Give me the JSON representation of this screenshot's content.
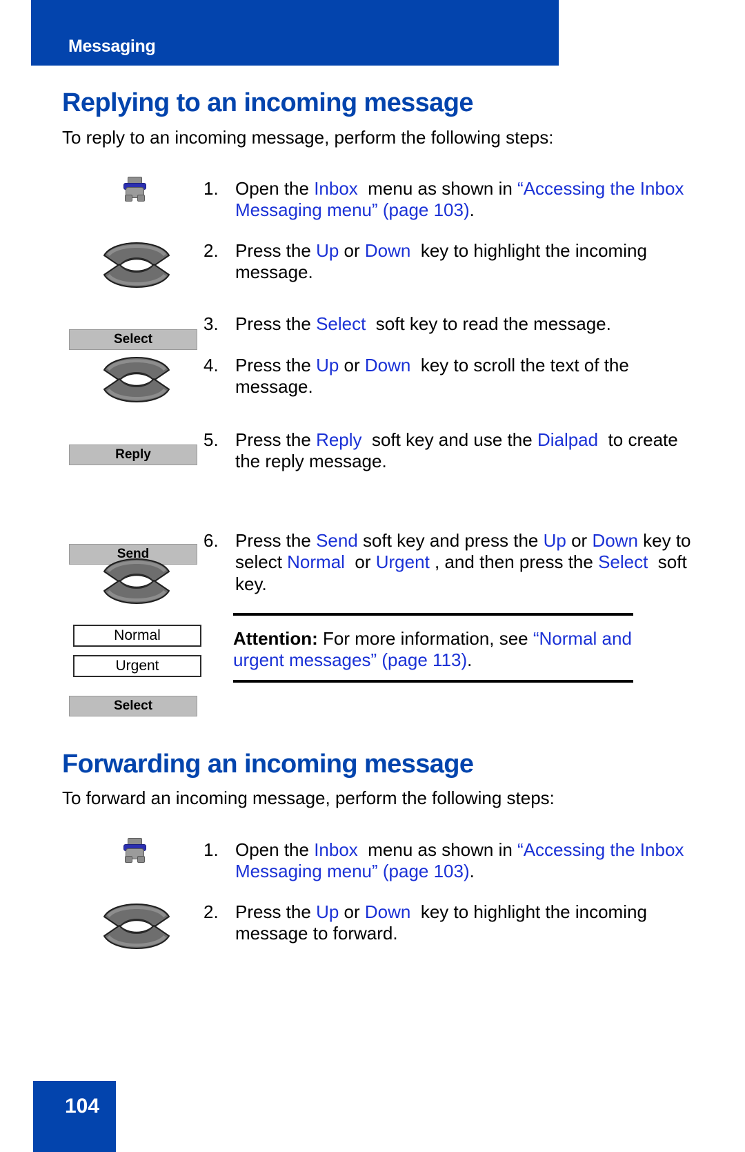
{
  "header": {
    "title": "Messaging",
    "bar_color": "#0344ad"
  },
  "colors": {
    "brand_blue": "#0344ad",
    "link_blue": "#1a31d6",
    "softkey_gray": "#bdbdbd"
  },
  "sections": [
    {
      "id": "replying",
      "heading": "Replying to an incoming message",
      "intro": "To reply to an incoming message, perform the following steps:",
      "steps": [
        {
          "number": "1.",
          "icon": "inbox-globe-icon",
          "text_runs": [
            {
              "t": "Open the ",
              "c": "black"
            },
            {
              "t": "Inbox",
              "c": "blue"
            },
            {
              "t": "  menu as shown in ",
              "c": "black"
            },
            {
              "t": "“Accessing the Inbox Messaging menu” (page 103)",
              "c": "blue"
            },
            {
              "t": ".",
              "c": "black"
            }
          ]
        },
        {
          "number": "2.",
          "icon": "navigation-rocker-key-icon",
          "text_runs": [
            {
              "t": "Press the ",
              "c": "black"
            },
            {
              "t": "Up",
              "c": "blue"
            },
            {
              "t": " or ",
              "c": "black"
            },
            {
              "t": "Down",
              "c": "blue"
            },
            {
              "t": "  key to highlight the incoming message.",
              "c": "black"
            }
          ]
        },
        {
          "number": "3.",
          "icon": "softkey-select",
          "softkey_label": "Select",
          "text_runs": [
            {
              "t": "Press the ",
              "c": "black"
            },
            {
              "t": "Select",
              "c": "blue"
            },
            {
              "t": "  soft key to read the message.",
              "c": "black"
            }
          ]
        },
        {
          "number": "4.",
          "icon": "navigation-rocker-key-icon",
          "text_runs": [
            {
              "t": "Press the ",
              "c": "black"
            },
            {
              "t": "Up",
              "c": "blue"
            },
            {
              "t": " or ",
              "c": "black"
            },
            {
              "t": "Down",
              "c": "blue"
            },
            {
              "t": "  key to scroll the text of the message.",
              "c": "black"
            }
          ]
        },
        {
          "number": "5.",
          "icon": "softkey-reply",
          "softkey_label": "Reply",
          "text_runs": [
            {
              "t": "Press the ",
              "c": "black"
            },
            {
              "t": "Reply",
              "c": "blue"
            },
            {
              "t": "  soft key and use the ",
              "c": "black"
            },
            {
              "t": "Dialpad",
              "c": "blue"
            },
            {
              "t": "  to create the reply message.",
              "c": "black"
            }
          ]
        },
        {
          "number": "6.",
          "icon": "softkey-send",
          "softkey_label": "Send",
          "text_runs": [
            {
              "t": "Press the ",
              "c": "black"
            },
            {
              "t": "Send",
              "c": "blue"
            },
            {
              "t": " soft key and press the ",
              "c": "black"
            },
            {
              "t": "Up",
              "c": "blue"
            },
            {
              "t": " or ",
              "c": "black"
            },
            {
              "t": "Down",
              "c": "blue"
            },
            {
              "t": " key to select ",
              "c": "black"
            },
            {
              "t": "Normal",
              "c": "blue"
            },
            {
              "t": "  or ",
              "c": "black"
            },
            {
              "t": "Urgent",
              "c": "blue"
            },
            {
              "t": " , and then press the ",
              "c": "black"
            },
            {
              "t": "Select",
              "c": "blue"
            },
            {
              "t": "  soft key.",
              "c": "black"
            }
          ]
        }
      ],
      "priority_options": [
        "Normal",
        "Urgent"
      ],
      "final_softkey_label": "Select",
      "note": {
        "label": "Attention:",
        "body_before": " For more information, see ",
        "link": "“Normal and urgent messages” (page 113)",
        "body_after": "."
      }
    },
    {
      "id": "forwarding",
      "heading": "Forwarding an incoming message",
      "intro": "To forward an incoming message, perform the following steps:",
      "steps": [
        {
          "number": "1.",
          "icon": "inbox-globe-icon",
          "text_runs": [
            {
              "t": "Open the ",
              "c": "black"
            },
            {
              "t": "Inbox",
              "c": "blue"
            },
            {
              "t": "  menu as shown in ",
              "c": "black"
            },
            {
              "t": "“Accessing the Inbox Messaging menu” (page 103)",
              "c": "blue"
            },
            {
              "t": ".",
              "c": "black"
            }
          ]
        },
        {
          "number": "2.",
          "icon": "navigation-rocker-key-icon",
          "text_runs": [
            {
              "t": "Press the ",
              "c": "black"
            },
            {
              "t": "Up",
              "c": "blue"
            },
            {
              "t": " or ",
              "c": "black"
            },
            {
              "t": "Down",
              "c": "blue"
            },
            {
              "t": "  key to highlight the incoming message to forward.",
              "c": "black"
            }
          ]
        }
      ]
    }
  ],
  "folio": {
    "page_number": "104"
  }
}
